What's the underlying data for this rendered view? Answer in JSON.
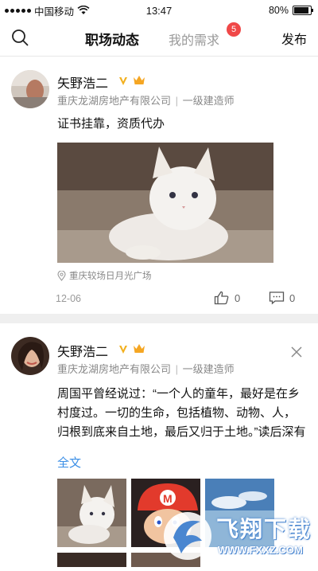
{
  "status_bar": {
    "carrier": "中国移动",
    "time": "13:47",
    "battery": "80%",
    "battery_level": 0.8
  },
  "nav": {
    "active_tab": "职场动态",
    "tab": "我的需求",
    "badge_count": "5",
    "publish": "发布",
    "search_icon": "search-icon"
  },
  "posts": [
    {
      "author": "矢野浩二",
      "company": "重庆龙湖房地产有限公司",
      "separator": "|",
      "title": "一级建造师",
      "text": "证书挂靠，资质代办",
      "location": "重庆较场日月光广场",
      "date": "12-06",
      "likes": "0",
      "comments": "0"
    },
    {
      "author": "矢野浩二",
      "company": "重庆龙湖房地产有限公司",
      "separator": "|",
      "title": "一级建造师",
      "text": "周国平曾经说过：“一个人的童年，最好是在乡村度过。一切的生命，包括植物、动物、人，归根到底来自土地，最后又归于土地。”读后深有感触，我很庆幸我的童年",
      "full_text_link": "全文"
    }
  ],
  "watermark": {
    "brand": "飞翔下载",
    "url": "WWW.FXXZ.COM"
  },
  "colors": {
    "accent": "#3a8ee6",
    "badge": "#f04848",
    "v_badge": "#f2b01e",
    "crown": "#f5a623"
  }
}
